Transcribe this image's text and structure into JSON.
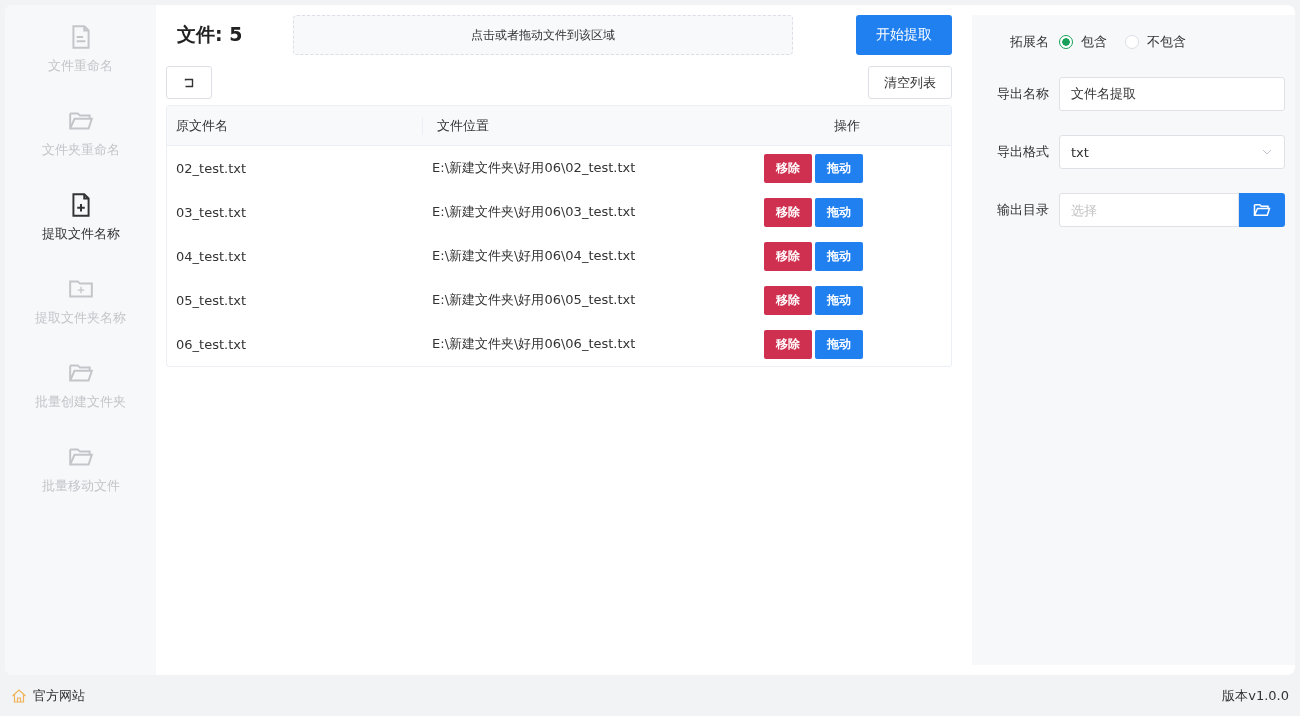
{
  "sidebar": {
    "items": [
      {
        "label": "文件重命名",
        "kind": "file",
        "selected": false
      },
      {
        "label": "文件夹重命名",
        "kind": "folder",
        "selected": false
      },
      {
        "label": "提取文件名称",
        "kind": "file-plus",
        "selected": true
      },
      {
        "label": "提取文件夹名称",
        "kind": "folder-plus",
        "selected": false
      },
      {
        "label": "批量创建文件夹",
        "kind": "folder",
        "selected": false
      },
      {
        "label": "批量移动文件",
        "kind": "folder",
        "selected": false
      }
    ]
  },
  "file_count": "文件: 5",
  "drop_zone": "点击或者拖动文件到该区域",
  "start_button": "开始提取",
  "clear_button": "清空列表",
  "table": {
    "columns": [
      "原文件名",
      "文件位置",
      "操作"
    ],
    "rows": [
      {
        "name": "02_test.txt",
        "path": "E:\\新建文件夹\\好用06\\02_test.txt",
        "remove": "移除",
        "move": "拖动"
      },
      {
        "name": "03_test.txt",
        "path": "E:\\新建文件夹\\好用06\\03_test.txt",
        "remove": "移除",
        "move": "拖动"
      },
      {
        "name": "04_test.txt",
        "path": "E:\\新建文件夹\\好用06\\04_test.txt",
        "remove": "移除",
        "move": "拖动"
      },
      {
        "name": "05_test.txt",
        "path": "E:\\新建文件夹\\好用06\\05_test.txt",
        "remove": "移除",
        "move": "拖动"
      },
      {
        "name": "06_test.txt",
        "path": "E:\\新建文件夹\\好用06\\06_test.txt",
        "remove": "移除",
        "move": "拖动"
      }
    ]
  },
  "settings": {
    "extension": {
      "label": "拓展名",
      "options": [
        {
          "label": "包含",
          "selected": true
        },
        {
          "label": "不包含",
          "selected": false
        }
      ]
    },
    "export_name": {
      "label": "导出名称",
      "value": "文件名提取"
    },
    "export_format": {
      "label": "导出格式",
      "value": "txt"
    },
    "output_dir": {
      "label": "输出目录",
      "placeholder": "选择"
    }
  },
  "status_bar": {
    "website": "官方网站",
    "version": "版本v1.0.0"
  }
}
